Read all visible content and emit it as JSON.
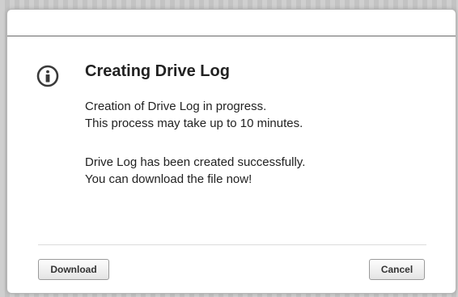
{
  "dialog": {
    "title": "Creating Drive Log",
    "icon": "info-icon",
    "progress_lines": [
      "Creation of Drive Log in progress.",
      "This process may take up to 10 minutes."
    ],
    "success_lines": [
      "Drive Log has been created successfully.",
      "You can download the file now!"
    ],
    "buttons": {
      "download_label": "Download",
      "cancel_label": "Cancel"
    }
  },
  "colors": {
    "text": "#222222",
    "icon": "#3a3a3a",
    "backdrop": "#c9c9c9"
  }
}
